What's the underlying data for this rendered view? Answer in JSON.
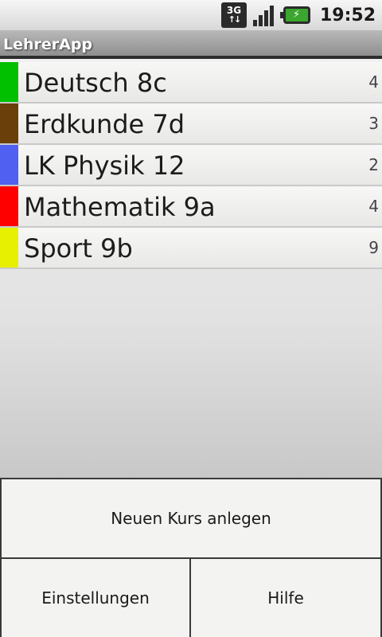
{
  "statusbar": {
    "network": "3G",
    "signal_icon": "signal-icon",
    "battery_icon": "battery-charging-icon",
    "time": "19:52"
  },
  "app": {
    "title": "LehrerApp"
  },
  "courses": [
    {
      "name": "Deutsch 8c",
      "count": "4",
      "color": "#00c000"
    },
    {
      "name": "Erdkunde 7d",
      "count": "3",
      "color": "#6b3f0a"
    },
    {
      "name": "LK Physik 12",
      "count": "2",
      "color": "#5060f0"
    },
    {
      "name": "Mathematik 9a",
      "count": "4",
      "color": "#ff0000"
    },
    {
      "name": "Sport 9b",
      "count": "9",
      "color": "#e6f000"
    }
  ],
  "menu": {
    "new_course": "Neuen Kurs anlegen",
    "settings": "Einstellungen",
    "help": "Hilfe"
  }
}
